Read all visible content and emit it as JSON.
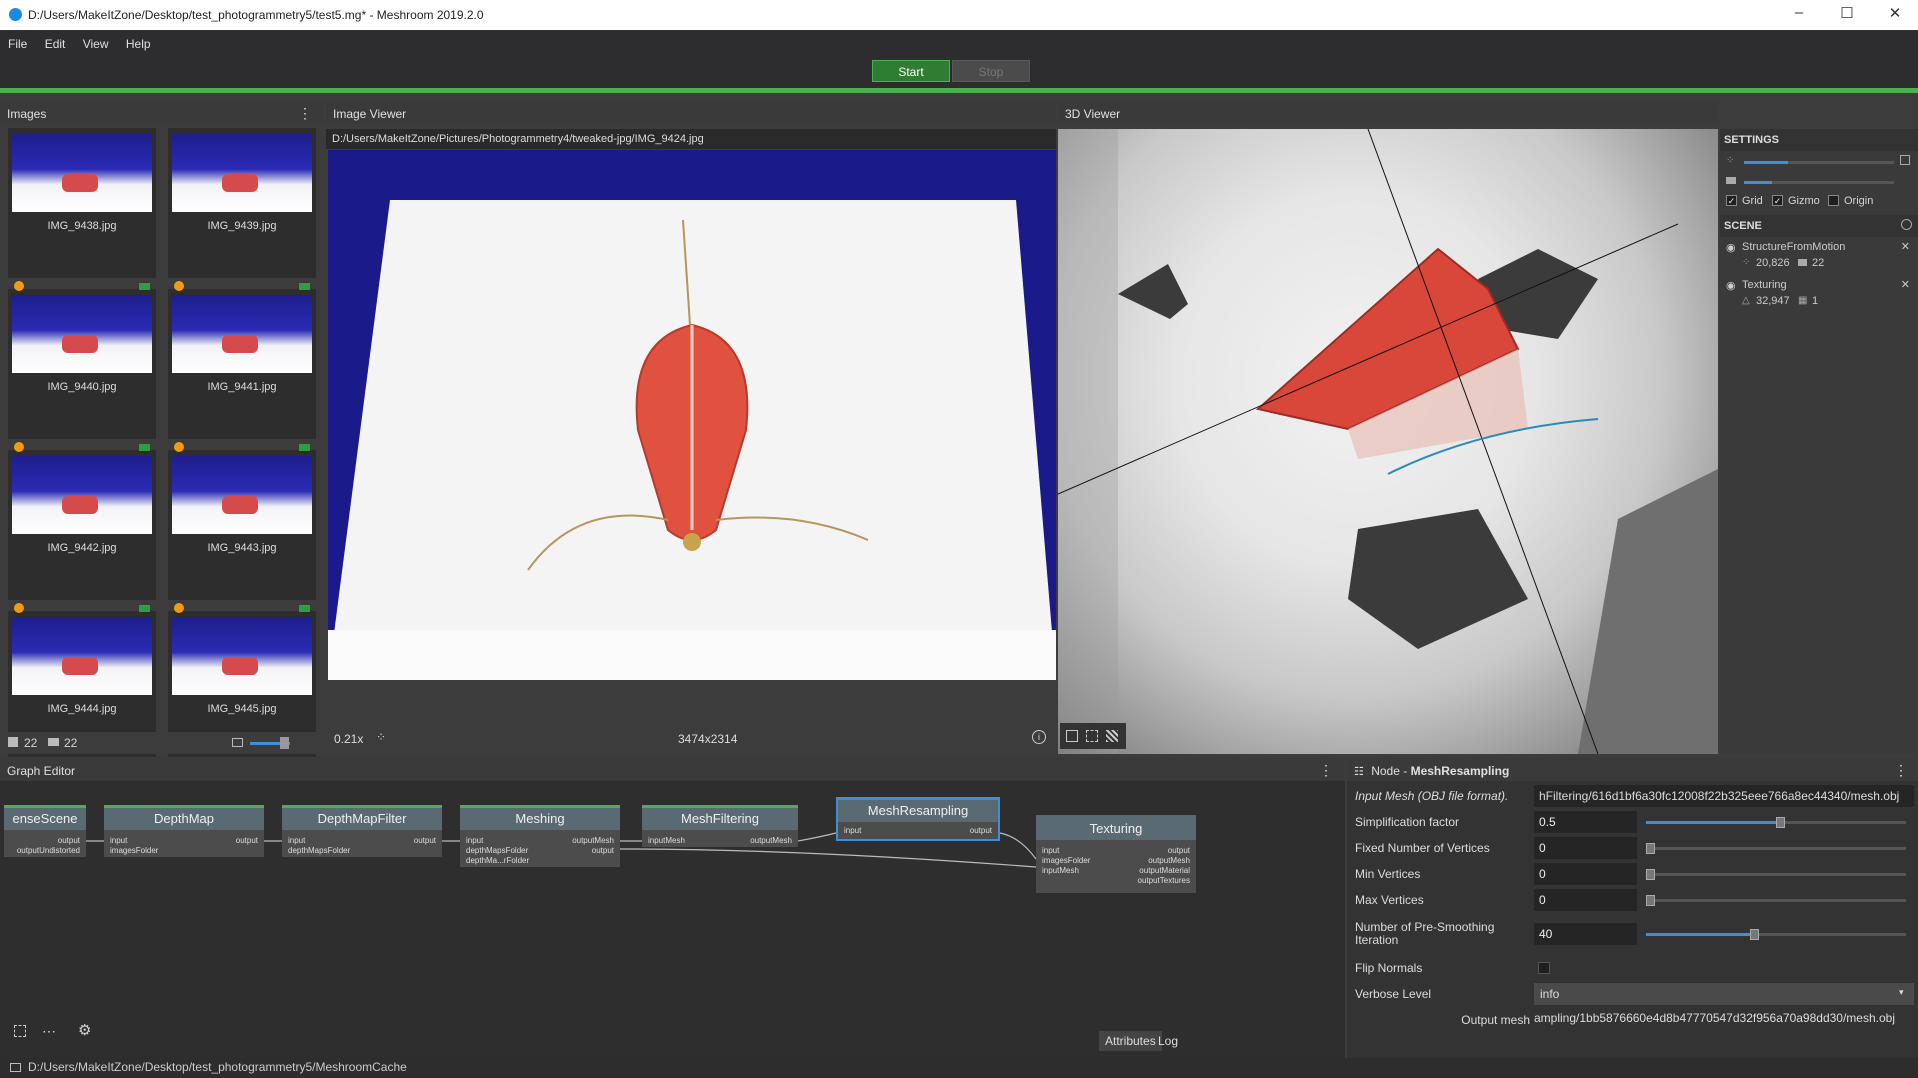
{
  "window": {
    "title": "D:/Users/MakeItZone/Desktop/test_photogrammetry5/test5.mg* - Meshroom 2019.2.0",
    "controls": [
      "–",
      "☐",
      "✕"
    ]
  },
  "menu": [
    "File",
    "Edit",
    "View",
    "Help"
  ],
  "run": {
    "start_label": "Start",
    "stop_label": "Stop"
  },
  "images_panel": {
    "title": "Images",
    "items": [
      {
        "name": "IMG_9438.jpg"
      },
      {
        "name": "IMG_9439.jpg"
      },
      {
        "name": "IMG_9440.jpg"
      },
      {
        "name": "IMG_9441.jpg"
      },
      {
        "name": "IMG_9442.jpg"
      },
      {
        "name": "IMG_9443.jpg"
      },
      {
        "name": "IMG_9444.jpg"
      },
      {
        "name": "IMG_9445.jpg"
      }
    ],
    "count_images": "22",
    "count_cameras": "22"
  },
  "image_viewer": {
    "title": "Image Viewer",
    "path": "D:/Users/MakeItZone/Pictures/Photogrammetry4/tweaked-jpg/IMG_9424.jpg",
    "zoom": "0.21x",
    "resolution": "3474x2314"
  },
  "viewer3d": {
    "title": "3D Viewer",
    "settings_title": "SETTINGS",
    "grid_label": "Grid",
    "gizmo_label": "Gizmo",
    "origin_label": "Origin",
    "scene_title": "SCENE",
    "scene_items": [
      {
        "name": "StructureFromMotion",
        "points": "20,826",
        "cameras": "22"
      },
      {
        "name": "Texturing",
        "triangles": "32,947",
        "textures": "1"
      }
    ]
  },
  "graph_editor": {
    "title": "Graph Editor",
    "nodes": [
      {
        "title": "enseScene",
        "ports": [
          "output",
          "outputUndistorted"
        ]
      },
      {
        "title": "DepthMap",
        "ports": [
          "input",
          "imagesFolder",
          "output"
        ]
      },
      {
        "title": "DepthMapFilter",
        "ports": [
          "input",
          "depthMapsFolder",
          "output"
        ]
      },
      {
        "title": "Meshing",
        "ports": [
          "input",
          "depthMapsFolder",
          "depthMa...rFolder",
          "outputMesh",
          "output"
        ]
      },
      {
        "title": "MeshFiltering",
        "ports": [
          "inputMesh",
          "outputMesh"
        ]
      },
      {
        "title": "MeshResampling",
        "ports": [
          "input",
          "output"
        ]
      },
      {
        "title": "Texturing",
        "ports": [
          "input",
          "imagesFolder",
          "inputMesh",
          "output",
          "outputMesh",
          "outputMaterial",
          "outputTextures"
        ]
      }
    ]
  },
  "attributes": {
    "node_label": "Node - ",
    "node_name": "MeshResampling",
    "rows": [
      {
        "label": "Input Mesh (OBJ file format).",
        "value": "hFiltering/616d1bf6a30fc12008f22b325eee766a8ec44340/mesh.obj"
      },
      {
        "label": "Simplification factor",
        "value": "0.5"
      },
      {
        "label": "Fixed Number of Vertices",
        "value": "0"
      },
      {
        "label": "Min Vertices",
        "value": "0"
      },
      {
        "label": "Max Vertices",
        "value": "0"
      },
      {
        "label": "Number of Pre-Smoothing Iteration",
        "value": "40"
      },
      {
        "label": "Flip Normals",
        "value": ""
      },
      {
        "label": "Verbose Level",
        "value": "info"
      },
      {
        "label": "Output mesh",
        "value": "ampling/1bb5876660e4d8b47770547d32f956a70a98dd30/mesh.obj"
      }
    ],
    "slider_levels": {
      "simplification": 0.5,
      "fixed": 0,
      "min": 0,
      "max": 0,
      "presmoothing": 0.4
    },
    "tabs": [
      "Attributes",
      "Log"
    ]
  },
  "status": {
    "cache_path": "D:/Users/MakeItZone/Desktop/test_photogrammetry5/MeshroomCache"
  },
  "colors": {
    "accent": "#4caf50",
    "start": "#2e7d32",
    "selected_node": "#3f8fd8"
  }
}
